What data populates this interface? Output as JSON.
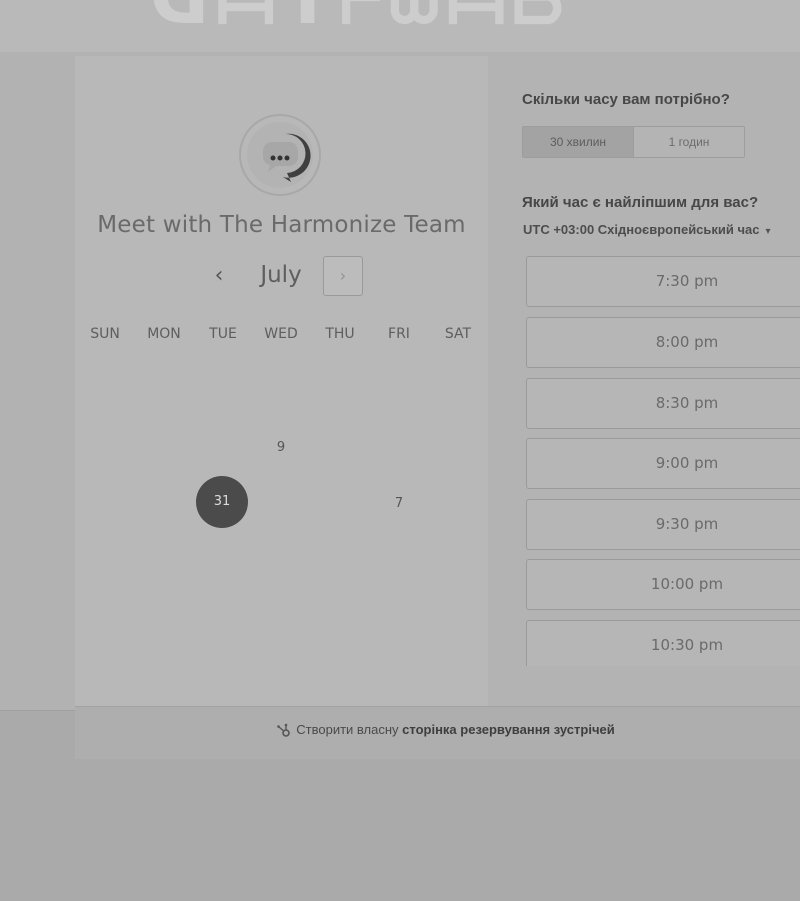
{
  "booking": {
    "title": "Meet with The Harmonize Team",
    "avatar_icon": "chat-bubble-icon",
    "calendar": {
      "month": "July",
      "prev_label": "‹",
      "next_label": "›",
      "weekdays": [
        "SUN",
        "MON",
        "TUE",
        "WED",
        "THU",
        "FRI",
        "SAT"
      ],
      "days": [
        {
          "label": "9",
          "weekday": "WED",
          "row": 1
        },
        {
          "label": "31",
          "weekday": "TUE",
          "row": 2,
          "selected": true
        },
        {
          "label": "7",
          "weekday": "FRI",
          "row": 2
        }
      ]
    },
    "duration": {
      "question": "Скільки часу вам потрібно?",
      "options": [
        "30 хвилин",
        "1 годин"
      ],
      "selected": "30 хвилин"
    },
    "time": {
      "question": "Який час є найліпшим для вас?",
      "timezone": "UTC +03:00 Східноєвропейський час",
      "slots": [
        "7:30 pm",
        "8:00 pm",
        "8:30 pm",
        "9:00 pm",
        "9:30 pm",
        "10:00 pm",
        "10:30 pm"
      ]
    },
    "footer": {
      "icon": "hubspot-sprocket-icon",
      "prefix": "Створити власну",
      "link": "сторінка резервування зустрічей"
    }
  },
  "colors": {
    "selected_day": "#4b4b4b",
    "background": "#a9a9a9",
    "panel": "#b8b8b8"
  }
}
